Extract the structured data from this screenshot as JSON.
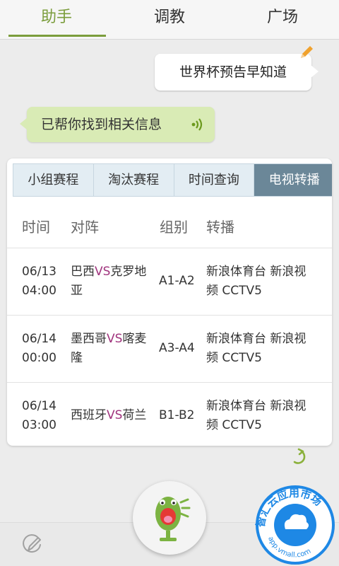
{
  "top_tabs": [
    {
      "label": "助手",
      "active": true
    },
    {
      "label": "调教",
      "active": false
    },
    {
      "label": "广场",
      "active": false
    }
  ],
  "colors": {
    "accent": "#7b9d3c",
    "vs": "#a0337d",
    "active_subtab": "#6b8798",
    "reply_bubble": "#d9ebb5"
  },
  "query": {
    "text": "世界杯预告早知道",
    "icon": "pencil-icon"
  },
  "reply": {
    "text": "已帮你找到相关信息",
    "icon": "speaker-icon"
  },
  "card": {
    "tabs": [
      {
        "label": "小组赛程",
        "active": false
      },
      {
        "label": "淘汰赛程",
        "active": false
      },
      {
        "label": "时间查询",
        "active": false
      },
      {
        "label": "电视转播",
        "active": true
      }
    ],
    "headers": {
      "time": "时间",
      "match": "对阵",
      "group": "组别",
      "broadcast": "转播"
    },
    "rows": [
      {
        "date": "06/13",
        "time": "04:00",
        "team1": "巴西",
        "vs": "VS",
        "team2_line1": "克罗地",
        "team2_line2": "亚",
        "group": "A1-A2",
        "broadcast_line1": "新浪体育台 新浪视",
        "broadcast_line2": "频 CCTV5"
      },
      {
        "date": "06/14",
        "time": "00:00",
        "team1": "墨西哥",
        "vs": "VS",
        "team2_line1": "喀麦",
        "team2_line2": "隆",
        "group": "A3-A4",
        "broadcast_line1": "新浪体育台 新浪视",
        "broadcast_line2": "频 CCTV5"
      },
      {
        "date": "06/14",
        "time": "03:00",
        "team1": "西班牙",
        "vs": "VS",
        "team2_line1": "荷兰",
        "team2_line2": "",
        "group": "B1-B2",
        "broadcast_line1": "新浪体育台 新浪视",
        "broadcast_line2": "频 CCTV5"
      }
    ]
  },
  "bottom": {
    "edit_icon": "edit-icon",
    "mic_icon": "mic-icon",
    "refresh_icon": "refresh-icon"
  },
  "watermark": {
    "top_text": "智汇云应用市场",
    "bottom_text": "app.vmall.com"
  }
}
